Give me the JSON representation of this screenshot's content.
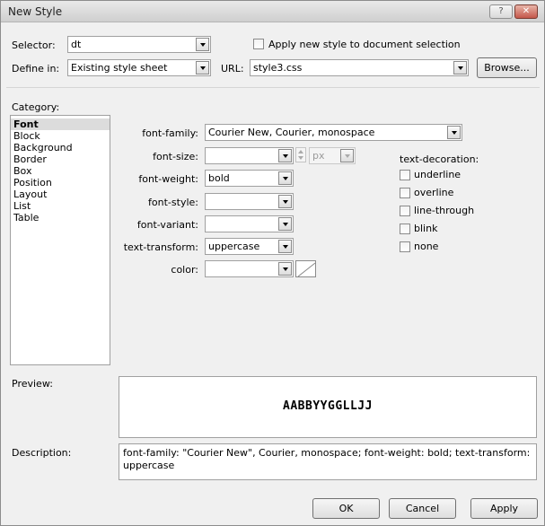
{
  "window": {
    "title": "New Style",
    "help_glyph": "?",
    "close_glyph": "✕"
  },
  "top": {
    "selector_label": "Selector:",
    "selector_value": "dt",
    "apply_checkbox_label": "Apply new style to document selection",
    "define_label": "Define in:",
    "define_value": "Existing style sheet",
    "url_label": "URL:",
    "url_value": "style3.css",
    "browse_label": "Browse..."
  },
  "category": {
    "label": "Category:",
    "items": [
      "Font",
      "Block",
      "Background",
      "Border",
      "Box",
      "Position",
      "Layout",
      "List",
      "Table"
    ],
    "selected": "Font"
  },
  "font": {
    "family_label": "font-family:",
    "family_value": "Courier New, Courier, monospace",
    "size_label": "font-size:",
    "size_value": "",
    "size_unit": "px",
    "weight_label": "font-weight:",
    "weight_value": "bold",
    "style_label": "font-style:",
    "style_value": "",
    "variant_label": "font-variant:",
    "variant_value": "",
    "transform_label": "text-transform:",
    "transform_value": "uppercase",
    "color_label": "color:",
    "color_value": ""
  },
  "decoration": {
    "label": "text-decoration:",
    "options": [
      "underline",
      "overline",
      "line-through",
      "blink",
      "none"
    ]
  },
  "preview": {
    "label": "Preview:",
    "text": "AABBYYGGLLJJ"
  },
  "description": {
    "label": "Description:",
    "text": "font-family: \"Courier New\", Courier, monospace; font-weight: bold; text-transform: uppercase"
  },
  "buttons": {
    "ok": "OK",
    "cancel": "Cancel",
    "apply": "Apply"
  }
}
